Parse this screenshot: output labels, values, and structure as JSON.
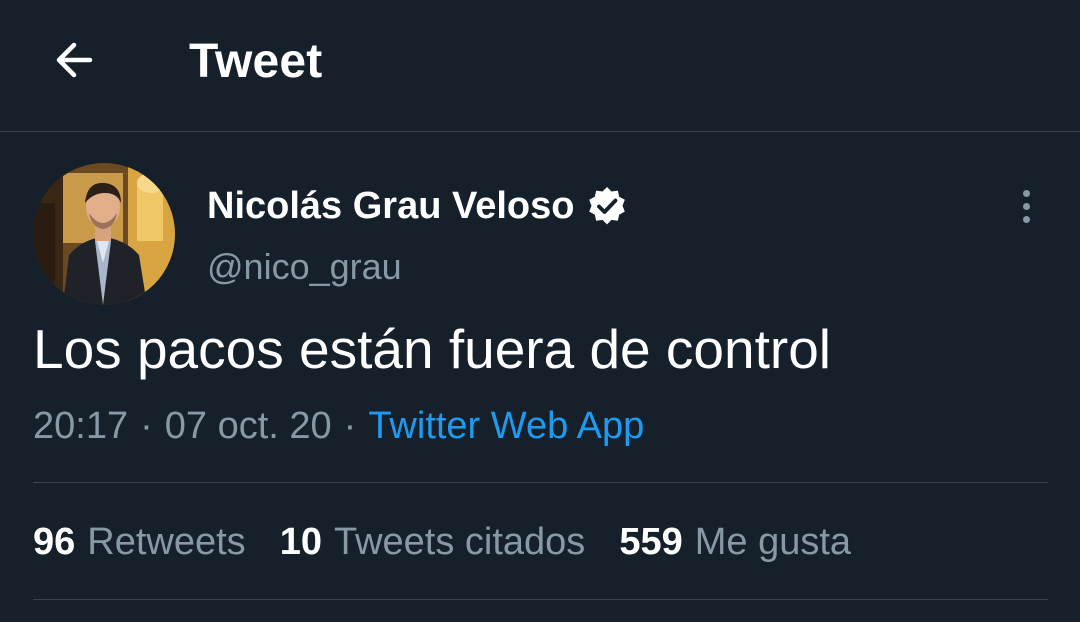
{
  "header": {
    "back_icon": "arrow-left-icon",
    "title": "Tweet"
  },
  "tweet": {
    "author": {
      "display_name": "Nicolás Grau Veloso",
      "handle": "@nico_grau",
      "verified": true,
      "verified_icon": "verified-badge-icon",
      "avatar_icon": "avatar-photo"
    },
    "more_icon": "more-vertical-icon",
    "text": "Los pacos están fuera de control",
    "time": "20:17",
    "date": "07 oct. 20",
    "separator": "·",
    "source": "Twitter Web App"
  },
  "stats": [
    {
      "count": "96",
      "label": "Retweets"
    },
    {
      "count": "10",
      "label": "Tweets citados"
    },
    {
      "count": "559",
      "label": "Me gusta"
    }
  ],
  "colors": {
    "background": "#15202b",
    "divider": "#38444d",
    "secondary_text": "#8899a6",
    "link": "#1d9bf0"
  }
}
